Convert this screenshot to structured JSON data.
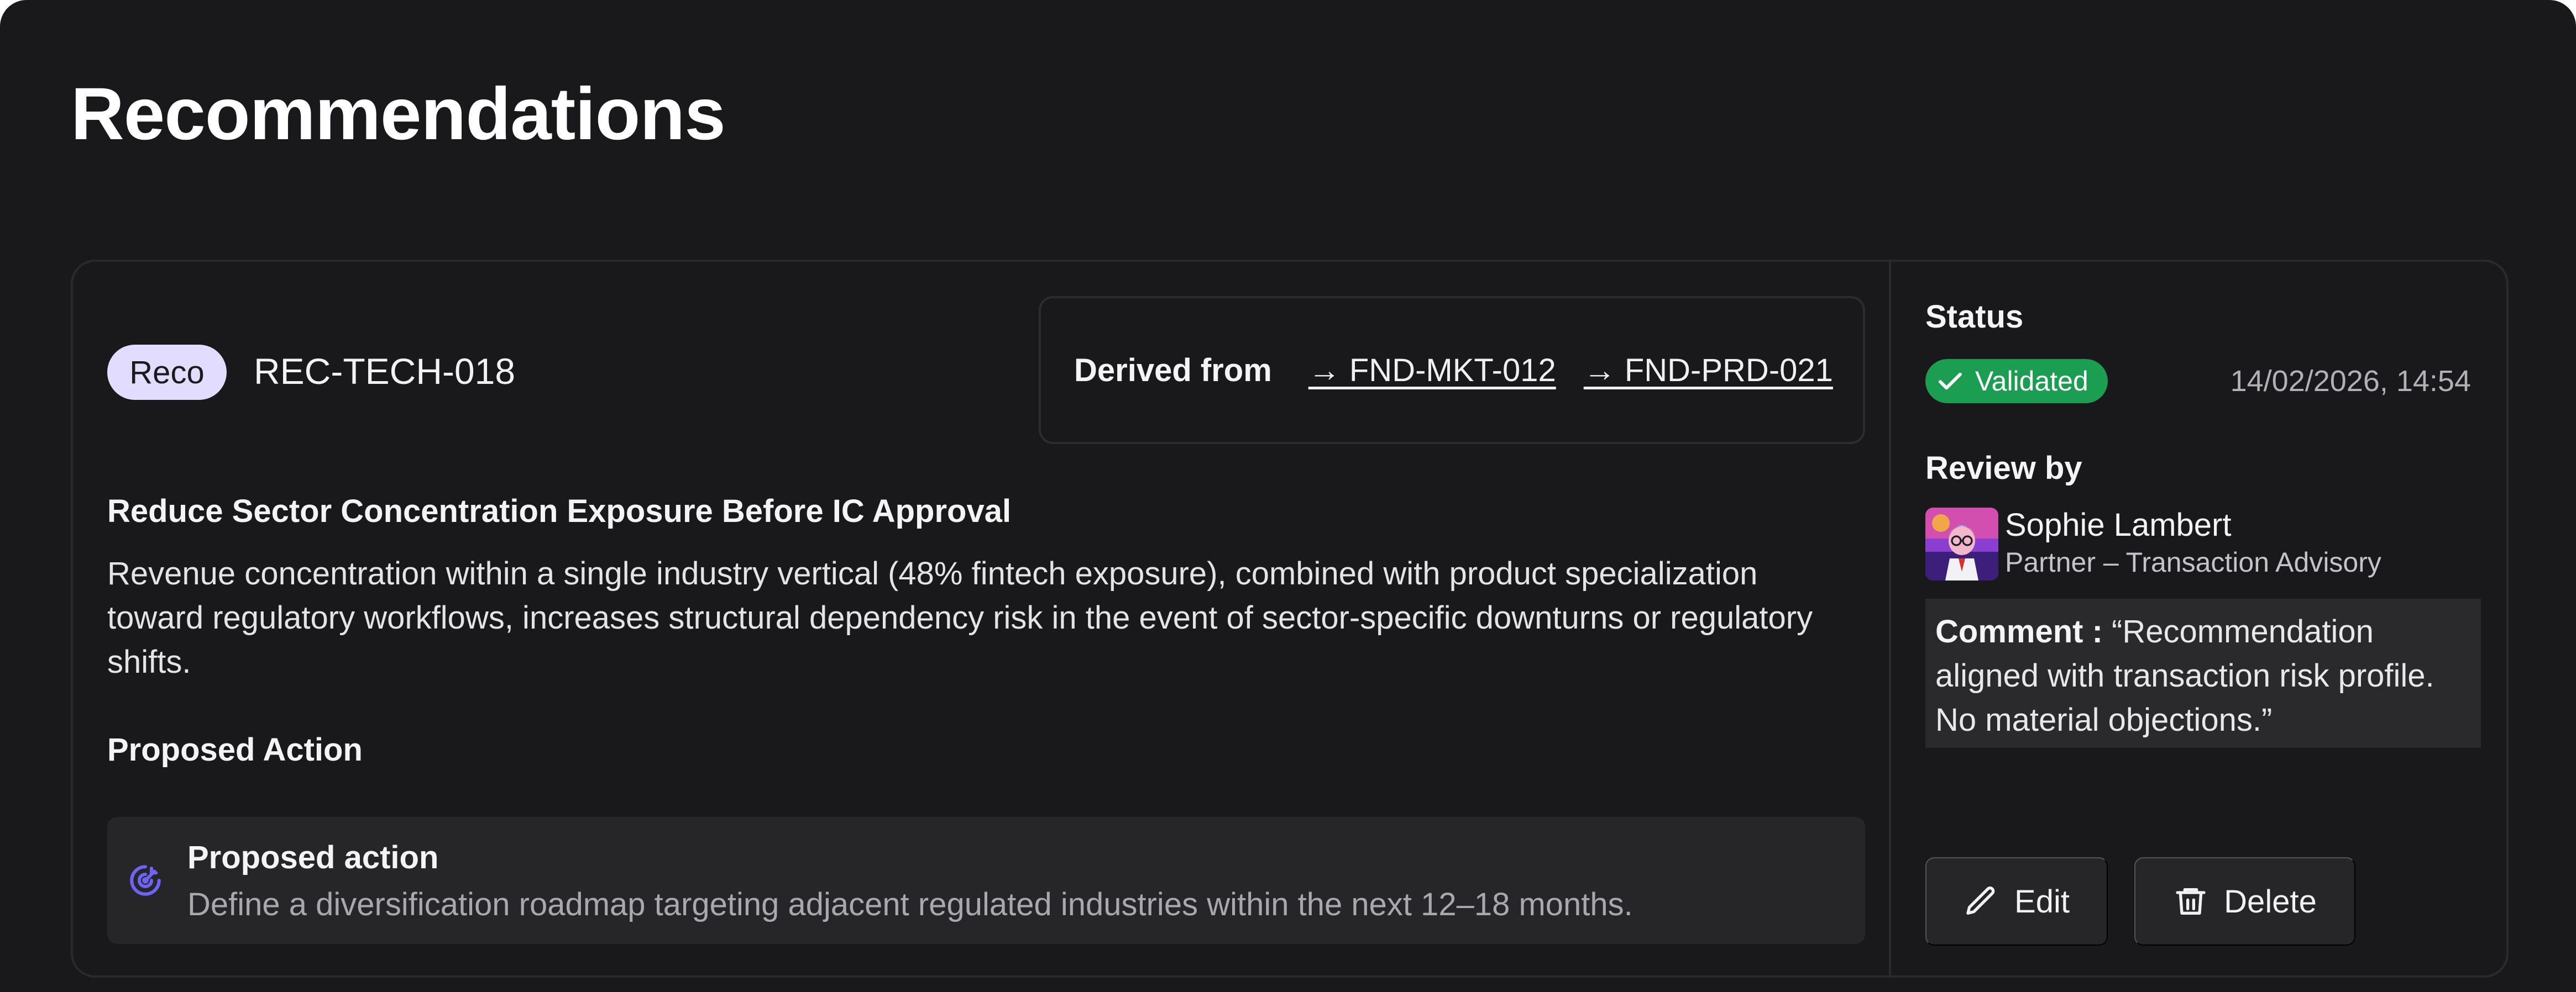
{
  "page": {
    "title": "Recommendations"
  },
  "recommendation": {
    "badge": "Reco",
    "id": "REC-TECH-018",
    "derived_from": {
      "label": "Derived from",
      "links": [
        "→ FND-MKT-012",
        "→ FND-PRD-021"
      ]
    },
    "title": "Reduce Sector Concentration Exposure Before IC Approval",
    "description": "Revenue concentration within a single industry vertical (48% fintech exposure), combined with product specialization toward regulatory workflows, increases structural dependency risk in the event of sector-specific downturns or regulatory shifts.",
    "proposed_action_heading": "Proposed Action",
    "proposed_action": {
      "icon": "target-icon",
      "title": "Proposed action",
      "text": "Define a diversification roadmap targeting adjacent regulated industries within the next 12–18 months."
    }
  },
  "review": {
    "status_label": "Status",
    "status": "Validated",
    "status_color": "#1c9e52",
    "timestamp": "14/02/2026, 14:54",
    "review_by_label": "Review by",
    "reviewer": {
      "name": "Sophie Lambert",
      "role": "Partner – Transaction Advisory"
    },
    "comment_label": "Comment :",
    "comment": "“Recommendation aligned with transaction risk profile. No material objections.”",
    "actions": {
      "edit": "Edit",
      "delete": "Delete"
    }
  },
  "colors": {
    "background": "#19191b",
    "badge": "#e2dcff",
    "accent": "#6f63f5"
  }
}
